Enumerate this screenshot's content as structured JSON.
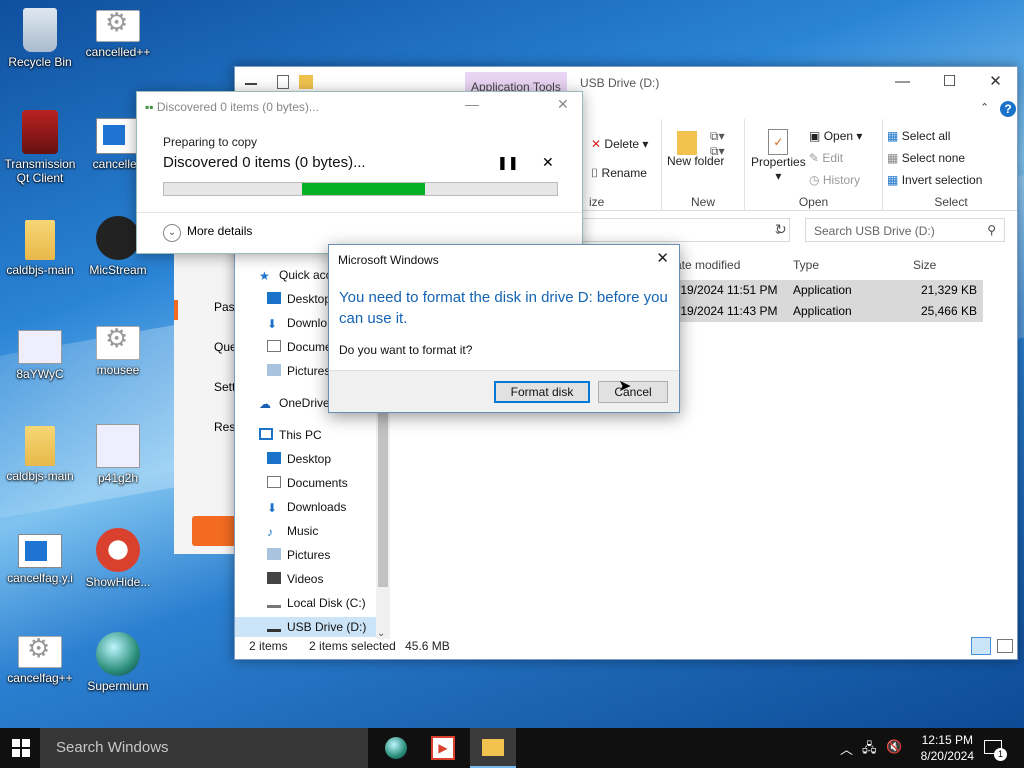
{
  "desktop": {
    "icons": [
      {
        "label": "Recycle Bin",
        "icon": "recycle-bin-icon"
      },
      {
        "label": "cancelled++",
        "icon": "application-icon"
      },
      {
        "label": "Transmission Qt Client",
        "icon": "transmission-icon"
      },
      {
        "label": "cancelled",
        "icon": "application-window-icon"
      },
      {
        "label": "caldbjs-main",
        "icon": "folder-icon"
      },
      {
        "label": "MicStream",
        "icon": "micstream-icon"
      },
      {
        "label": "8aYWyC",
        "icon": "image-icon"
      },
      {
        "label": "mousee",
        "icon": "application-icon"
      },
      {
        "label": "caldbjs-main",
        "icon": "zip-folder-icon"
      },
      {
        "label": "p41g2h",
        "icon": "image-icon"
      },
      {
        "label": "cancelfag.y.i",
        "icon": "application-window-icon"
      },
      {
        "label": "ShowHide...",
        "icon": "showhide-icon"
      },
      {
        "label": "cancelfag++",
        "icon": "application-icon"
      },
      {
        "label": "Supermium",
        "icon": "supermium-icon"
      }
    ]
  },
  "explorer": {
    "app_tools_tab": "Application Tools",
    "title": "USB Drive (D:)",
    "ribbon": {
      "delete": "Delete",
      "rename": "Rename",
      "organize_label": "ize",
      "new_folder": "New folder",
      "new_label": "New",
      "properties": "Properties",
      "open": "Open",
      "edit": "Edit",
      "history": "History",
      "open_label": "Open",
      "select_all": "Select all",
      "select_none": "Select none",
      "invert_selection": "Invert selection",
      "select_label": "Select"
    },
    "search_placeholder": "Search USB Drive (D:)",
    "nav": {
      "quick_access": "Quick acc",
      "desktop": "Desktop",
      "downloads": "Downlo",
      "documents": "Docume",
      "pictures": "Pictures",
      "onedrive": "OneDrive",
      "this_pc": "This PC",
      "pc_desktop": "Desktop",
      "pc_documents": "Documents",
      "pc_downloads": "Downloads",
      "pc_music": "Music",
      "pc_pictures": "Pictures",
      "pc_videos": "Videos",
      "local_disk": "Local Disk (C:)",
      "usb_drive": "USB Drive (D:)"
    },
    "columns": {
      "date": "ate modified",
      "type": "Type",
      "size": "Size"
    },
    "rows": [
      {
        "date": "/19/2024 11:51 PM",
        "type": "Application",
        "size": "21,329 KB"
      },
      {
        "date": "/19/2024 11:43 PM",
        "type": "Application",
        "size": "25,466 KB"
      }
    ],
    "status": {
      "items": "2 items",
      "selected": "2 items selected",
      "size": "45.6 MB"
    }
  },
  "side_app": {
    "items": [
      "Past",
      "Que",
      "Setti",
      "Res"
    ]
  },
  "copy_dialog": {
    "title": "Discovered 0 items (0 bytes)...",
    "subtitle": "Preparing to copy",
    "heading": "Discovered 0 items (0 bytes)...",
    "more_details": "More details",
    "progress_percent": 35
  },
  "message_box": {
    "title": "Microsoft Windows",
    "main_text": "You need to format the disk in drive D: before you can use it.",
    "sub_text": "Do you want to format it?",
    "format_button": "Format disk",
    "cancel_button": "Cancel"
  },
  "taskbar": {
    "search_placeholder": "Search Windows",
    "time": "12:15 PM",
    "date": "8/20/2024",
    "notification_count": "1"
  },
  "colors": {
    "accent": "#0078d7",
    "progress": "#06b025",
    "title_text": "#1464b4"
  }
}
